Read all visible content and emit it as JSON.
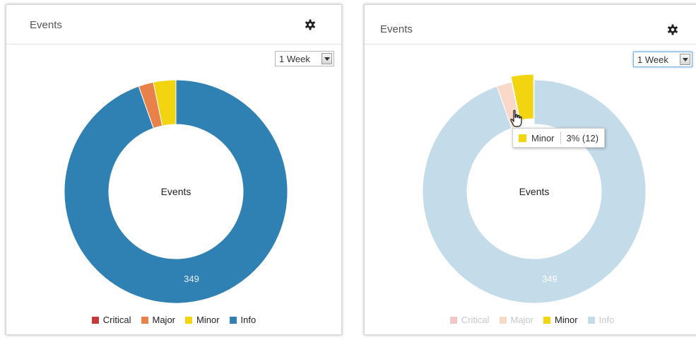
{
  "colors": {
    "critical": "#c23a3a",
    "major": "#e8824a",
    "minor": "#f2d411",
    "info": "#2f81b3",
    "critical_faded": "#f0c8c8",
    "major_faded": "#fad8c8",
    "info_faded": "#c4dcea",
    "minor_dark_edge": "#c9a800"
  },
  "icons": {
    "settings": "gear-icon",
    "dropdown": "chevron-down-icon",
    "pointer": "hand-pointer-icon"
  },
  "panels": [
    {
      "title": "Events",
      "range": "1 Week",
      "center_label": "Events",
      "info_value_label": "349"
    },
    {
      "title": "Events",
      "range": "1 Week",
      "center_label": "Events",
      "info_value_label": "349"
    }
  ],
  "tooltip": {
    "name": "Minor",
    "value": "3% (12)"
  },
  "chart_data": [
    {
      "type": "pie",
      "title": "Events",
      "categories": [
        "Critical",
        "Major",
        "Minor",
        "Info"
      ],
      "values": [
        0,
        8,
        12,
        349
      ],
      "legend": "bottom",
      "center_label": "Events",
      "data_labels": [
        "",
        "",
        "",
        "349"
      ]
    },
    {
      "type": "pie",
      "title": "Events",
      "categories": [
        "Critical",
        "Major",
        "Minor",
        "Info"
      ],
      "values": [
        0,
        8,
        12,
        349
      ],
      "legend": "bottom",
      "center_label": "Events",
      "data_labels": [
        "",
        "",
        "",
        "349"
      ],
      "highlighted": "Minor",
      "tooltip": "Minor 3% (12)"
    }
  ]
}
